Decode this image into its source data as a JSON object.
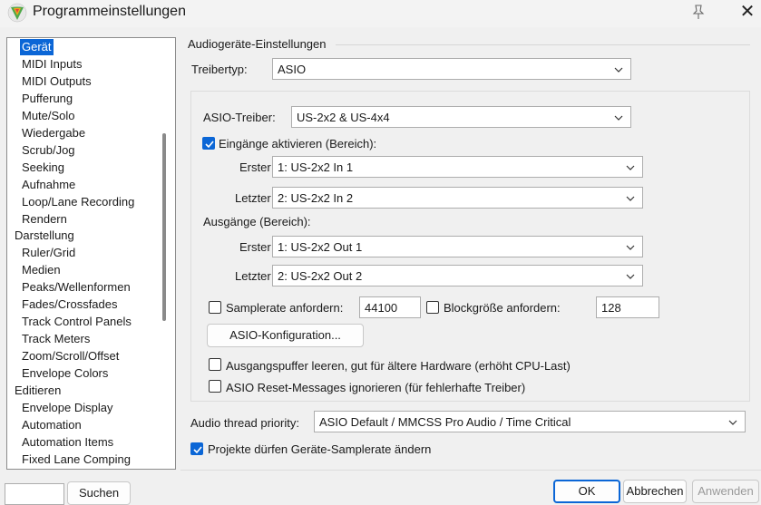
{
  "window": {
    "title": "Programmeinstellungen",
    "close_glyph": "✕"
  },
  "tree": {
    "items": [
      {
        "label": "Gerät",
        "level": 1,
        "selected": true
      },
      {
        "label": "MIDI Inputs",
        "level": 1
      },
      {
        "label": "MIDI Outputs",
        "level": 1
      },
      {
        "label": "Pufferung",
        "level": 1
      },
      {
        "label": "Mute/Solo",
        "level": 1
      },
      {
        "label": "Wiedergabe",
        "level": 1
      },
      {
        "label": "Scrub/Jog",
        "level": 1
      },
      {
        "label": "Seeking",
        "level": 1
      },
      {
        "label": "Aufnahme",
        "level": 1
      },
      {
        "label": "Loop/Lane Recording",
        "level": 1
      },
      {
        "label": "Rendern",
        "level": 1
      },
      {
        "label": "Darstellung",
        "level": 0
      },
      {
        "label": "Ruler/Grid",
        "level": 1
      },
      {
        "label": "Medien",
        "level": 1
      },
      {
        "label": "Peaks/Wellenformen",
        "level": 1
      },
      {
        "label": "Fades/Crossfades",
        "level": 1
      },
      {
        "label": "Track Control Panels",
        "level": 1
      },
      {
        "label": "Track Meters",
        "level": 1
      },
      {
        "label": "Zoom/Scroll/Offset",
        "level": 1
      },
      {
        "label": "Envelope Colors",
        "level": 1
      },
      {
        "label": "Editieren",
        "level": 0
      },
      {
        "label": "Envelope Display",
        "level": 1
      },
      {
        "label": "Automation",
        "level": 1
      },
      {
        "label": "Automation Items",
        "level": 1
      },
      {
        "label": "Fixed Lane Comping",
        "level": 1
      }
    ]
  },
  "audio": {
    "group_title": "Audiogeräte-Einstellungen",
    "driver_type_label": "Treibertyp:",
    "driver_type_value": "ASIO",
    "asio_driver_label": "ASIO-Treiber:",
    "asio_driver_value": "US-2x2 & US-4x4",
    "inputs_enable_label": "Eingänge aktivieren (Bereich):",
    "inputs_enabled": true,
    "first_label": "Erster",
    "last_label": "Letzter",
    "input_first_value": "1: US-2x2 In 1",
    "input_last_value": "2: US-2x2 In 2",
    "outputs_label": "Ausgänge (Bereich):",
    "output_first_value": "1: US-2x2 Out 1",
    "output_last_value": "2: US-2x2 Out 2",
    "samplerate_label": "Samplerate anfordern:",
    "samplerate_value": "44100",
    "samplerate_checked": false,
    "blocksize_label": "Blockgröße anfordern:",
    "blocksize_value": "128",
    "blocksize_checked": false,
    "asio_config_button": "ASIO-Konfiguration...",
    "flush_buffers_label": "Ausgangspuffer leeren, gut für ältere Hardware (erhöht CPU-Last)",
    "flush_buffers_checked": false,
    "ignore_reset_label": "ASIO Reset-Messages ignorieren (für fehlerhafte Treiber)",
    "ignore_reset_checked": false,
    "thread_priority_label": "Audio thread priority:",
    "thread_priority_value": "ASIO Default / MMCSS Pro Audio / Time Critical",
    "projects_samplerate_label": "Projekte dürfen Geräte-Samplerate ändern",
    "projects_samplerate_checked": true
  },
  "footer": {
    "search_value": "",
    "search_button": "Suchen",
    "ok_button": "OK",
    "cancel_button": "Abbrechen",
    "apply_button": "Anwenden"
  },
  "colors": {
    "accent": "#0b66d6"
  }
}
